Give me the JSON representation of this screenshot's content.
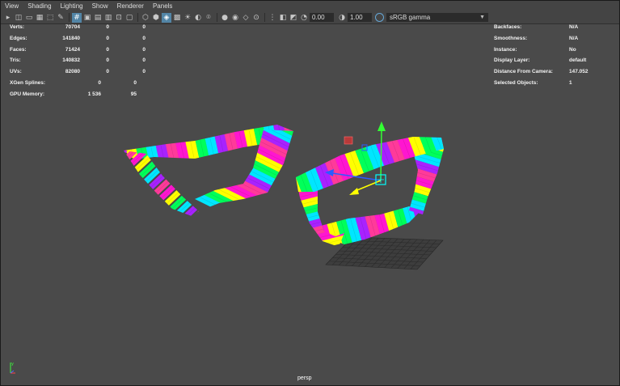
{
  "menubar": {
    "items": [
      "View",
      "Shading",
      "Lighting",
      "Show",
      "Renderer",
      "Panels"
    ]
  },
  "toolbar": {
    "exposure": "0.00",
    "gamma": "1.00",
    "color_space": "sRGB gamma"
  },
  "hud_left": [
    {
      "label": "Verts:",
      "v1": "70704",
      "v2": "0",
      "v3": "0"
    },
    {
      "label": "Edges:",
      "v1": "141840",
      "v2": "0",
      "v3": "0"
    },
    {
      "label": "Faces:",
      "v1": "71424",
      "v2": "0",
      "v3": "0"
    },
    {
      "label": "Tris:",
      "v1": "140832",
      "v2": "0",
      "v3": "0"
    },
    {
      "label": "UVs:",
      "v1": "82080",
      "v2": "0",
      "v3": "0"
    }
  ],
  "hud_left_extra": [
    {
      "label": "XGen Splines:",
      "v1": "0",
      "v2": "0"
    },
    {
      "label": "GPU Memory:",
      "v1": "1 536",
      "v2": "95"
    }
  ],
  "hud_right": [
    {
      "label": "Backfaces:",
      "value": "N/A"
    },
    {
      "label": "Smoothness:",
      "value": "N/A"
    },
    {
      "label": "Instance:",
      "value": "No"
    },
    {
      "label": "Display Layer:",
      "value": "default"
    },
    {
      "label": "Distance From Camera:",
      "value": "147.052"
    },
    {
      "label": "Selected Objects:",
      "value": "1"
    }
  ],
  "viewport": {
    "camera": "persp",
    "stripe_colors": [
      "#ff16d0",
      "#ffff00",
      "#00ff5a",
      "#00e6ff",
      "#a822ff",
      "#ff3a9a"
    ]
  }
}
